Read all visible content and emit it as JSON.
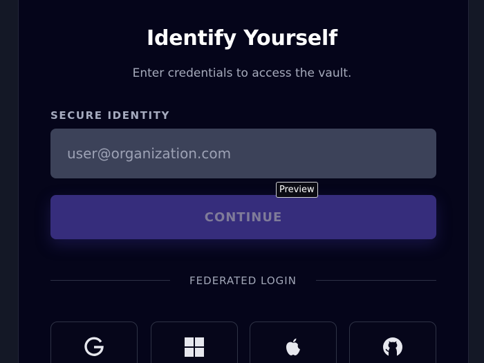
{
  "auth": {
    "title": "Identify Yourself",
    "subtitle": "Enter credentials to access the vault.",
    "identity_label": "SECURE IDENTITY",
    "email_placeholder": "user@organization.com",
    "email_value": "",
    "tooltip": "Preview",
    "continue_label": "CONTINUE",
    "divider_label": "FEDERATED LOGIN",
    "providers": [
      {
        "name": "Google",
        "icon": "google-icon"
      },
      {
        "name": "Microsoft",
        "icon": "windows-icon"
      },
      {
        "name": "Apple",
        "icon": "apple-icon"
      },
      {
        "name": "GitHub",
        "icon": "github-icon"
      }
    ]
  },
  "colors": {
    "page_background": "#141826",
    "card_background": "#05051a",
    "input_background": "#3c4259",
    "button_background": "#362d7c",
    "button_text": "#7f7b99",
    "muted_text": "#a6abbc"
  }
}
